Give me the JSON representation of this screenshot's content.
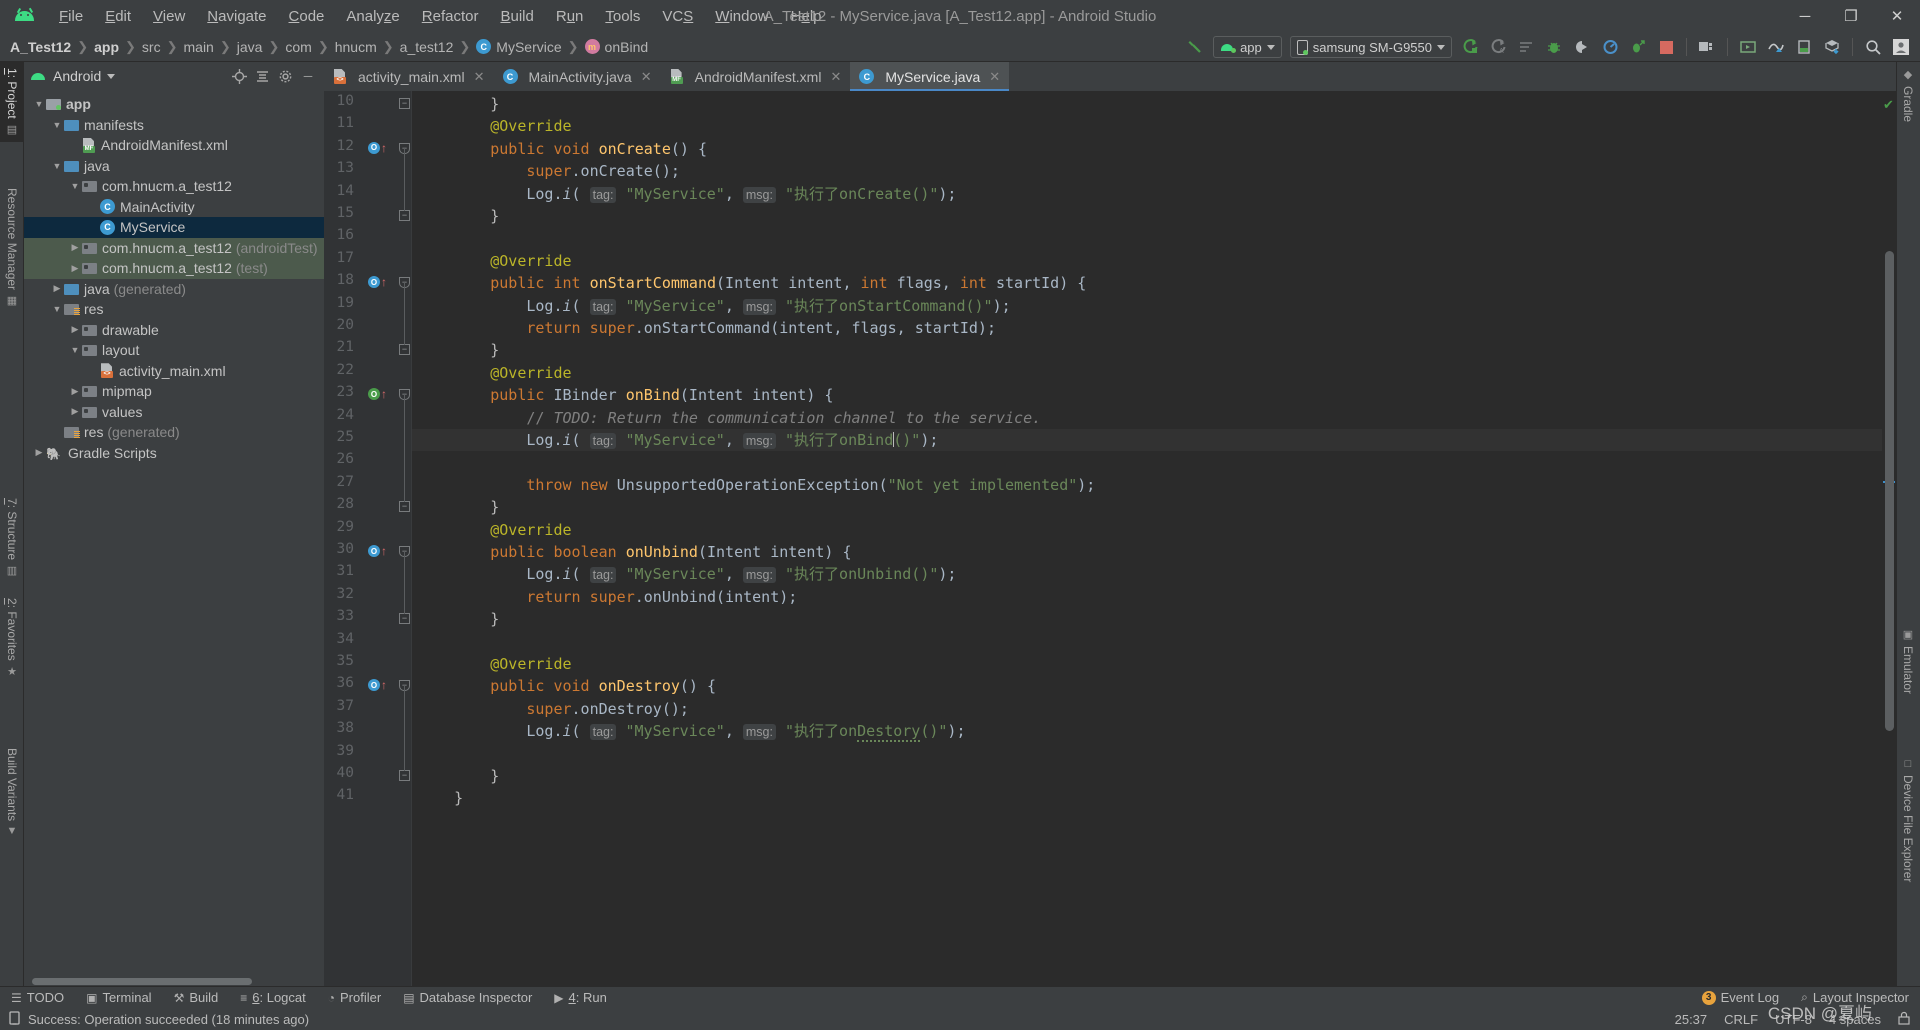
{
  "window": {
    "title": "A_Test12 - MyService.java [A_Test12.app] - Android Studio",
    "minimize": "─",
    "maximize": "❐",
    "close": "✕"
  },
  "menubar": {
    "items": [
      "File",
      "Edit",
      "View",
      "Navigate",
      "Code",
      "Analyze",
      "Refactor",
      "Build",
      "Run",
      "Tools",
      "VCS",
      "Window",
      "Help"
    ]
  },
  "breadcrumb": {
    "items": [
      {
        "label": "A_Test12",
        "bold": true,
        "icon": ""
      },
      {
        "label": "app",
        "bold": true,
        "icon": ""
      },
      {
        "label": "src",
        "bold": false,
        "icon": ""
      },
      {
        "label": "main",
        "bold": false,
        "icon": ""
      },
      {
        "label": "java",
        "bold": false,
        "icon": ""
      },
      {
        "label": "com",
        "bold": false,
        "icon": ""
      },
      {
        "label": "hnucm",
        "bold": false,
        "icon": ""
      },
      {
        "label": "a_test12",
        "bold": false,
        "icon": ""
      },
      {
        "label": "MyService",
        "bold": false,
        "icon": "class-icon",
        "glyph": "C"
      },
      {
        "label": "onBind",
        "bold": false,
        "icon": "method-icon",
        "glyph": "m"
      }
    ]
  },
  "toolbar": {
    "build_hammer": "build-icon",
    "run_config": "app",
    "device": "samsung SM-G9550",
    "icons": [
      "run-icon",
      "run-coverage-icon",
      "run-with-profiler-lines-icon",
      "debug-icon",
      "attach-debugger-icon",
      "profiler-icon",
      "debug-attach-icon",
      "stop-icon",
      "avd-manager-icon",
      "layout-editor-icon",
      "sdk-manager-icon",
      "device-manager-icon",
      "gradle-sync-icon",
      "search-icon",
      "account-icon"
    ]
  },
  "left_tool_window": {
    "tabs": [
      {
        "label": "1: Project",
        "underline": "1",
        "active": true
      },
      {
        "label": "Resource Manager",
        "active": false
      },
      {
        "label": "7: Structure",
        "underline": "7",
        "active": false
      },
      {
        "label": "2: Favorites",
        "underline": "2",
        "active": false
      },
      {
        "label": "Build Variants",
        "active": false
      }
    ]
  },
  "right_tool_window": {
    "tabs": [
      {
        "label": "Gradle",
        "icon": "elephant-icon"
      },
      {
        "label": "Emulator",
        "icon": "emulator-icon"
      },
      {
        "label": "Device File Explorer",
        "icon": "device-icon"
      }
    ]
  },
  "project_panel": {
    "view_name": "Android",
    "header_icons": [
      "locate-icon",
      "collapse-all-icon",
      "settings-gear-icon",
      "hide-icon"
    ],
    "tree": [
      {
        "label": "app",
        "indent": 0,
        "arrow": "down",
        "icon": "module-folder",
        "bold": true
      },
      {
        "label": "manifests",
        "indent": 1,
        "arrow": "down",
        "icon": "folder-blue"
      },
      {
        "label": "AndroidManifest.xml",
        "indent": 2,
        "arrow": "none",
        "icon": "xml-manifest"
      },
      {
        "label": "java",
        "indent": 1,
        "arrow": "down",
        "icon": "folder-blue"
      },
      {
        "label": "com.hnucm.a_test12",
        "indent": 2,
        "arrow": "down",
        "icon": "package"
      },
      {
        "label": "MainActivity",
        "indent": 3,
        "arrow": "none",
        "icon": "class"
      },
      {
        "label": "MyService",
        "indent": 3,
        "arrow": "none",
        "icon": "class",
        "selected": true
      },
      {
        "label": "com.hnucm.a_test12 (androidTest)",
        "indent": 2,
        "arrow": "right",
        "icon": "package",
        "green": true
      },
      {
        "label": "com.hnucm.a_test12 (test)",
        "indent": 2,
        "arrow": "right",
        "icon": "package",
        "green": true
      },
      {
        "label": "java (generated)",
        "indent": 1,
        "arrow": "right",
        "icon": "folder-gen"
      },
      {
        "label": "res",
        "indent": 1,
        "arrow": "down",
        "icon": "folder-res"
      },
      {
        "label": "drawable",
        "indent": 2,
        "arrow": "right",
        "icon": "package"
      },
      {
        "label": "layout",
        "indent": 2,
        "arrow": "down",
        "icon": "package"
      },
      {
        "label": "activity_main.xml",
        "indent": 3,
        "arrow": "none",
        "icon": "xml-layout"
      },
      {
        "label": "mipmap",
        "indent": 2,
        "arrow": "right",
        "icon": "package"
      },
      {
        "label": "values",
        "indent": 2,
        "arrow": "right",
        "icon": "package"
      },
      {
        "label": "res (generated)",
        "indent": 1,
        "arrow": "none",
        "icon": "folder-res"
      },
      {
        "label": "Gradle Scripts",
        "indent": 0,
        "arrow": "right",
        "icon": "gradle"
      }
    ]
  },
  "editor": {
    "tabs": [
      {
        "label": "activity_main.xml",
        "icon": "xml-layout-icon",
        "active": false
      },
      {
        "label": "MainActivity.java",
        "icon": "class-icon",
        "active": false
      },
      {
        "label": "AndroidManifest.xml",
        "icon": "xml-manifest-icon",
        "active": false
      },
      {
        "label": "MyService.java",
        "icon": "class-icon",
        "active": true
      }
    ],
    "close_glyph": "✕",
    "first_line": 10,
    "last_line": 41,
    "caret_line": 25
  },
  "code_lines": [
    {
      "n": 10,
      "html": "        }"
    },
    {
      "n": 11,
      "html": "        <span class='anno'>@Override</span>"
    },
    {
      "n": 12,
      "html": "        <span class='kw'>public</span> <span class='kw'>void</span> <span class='meth'>onCreate</span><span class='plain'>() {</span>",
      "gutter": "override-blue"
    },
    {
      "n": 13,
      "html": "            <span class='kw'>super</span><span class='plain'>.onCreate();</span>"
    },
    {
      "n": 14,
      "html": "            <span class='plain'>Log.</span><span class='plain' style='font-style:italic'>i</span><span class='plain'>( </span><span class='hint'>tag:</span><span class='str'> \"MyService\"</span><span class='plain'>, </span><span class='hint'>msg:</span><span class='str'> \"执行了onCreate()\"</span><span class='plain'>);</span>"
    },
    {
      "n": 15,
      "html": "        }"
    },
    {
      "n": 16,
      "html": ""
    },
    {
      "n": 17,
      "html": "        <span class='anno'>@Override</span>"
    },
    {
      "n": 18,
      "html": "        <span class='kw'>public</span> <span class='kw'>int</span> <span class='meth'>onStartCommand</span><span class='plain'>(Intent intent, </span><span class='kw'>int</span><span class='plain'> flags, </span><span class='kw'>int</span><span class='plain'> startId) {</span>",
      "gutter": "override-blue"
    },
    {
      "n": 19,
      "html": "            <span class='plain'>Log.</span><span class='plain' style='font-style:italic'>i</span><span class='plain'>( </span><span class='hint'>tag:</span><span class='str'> \"MyService\"</span><span class='plain'>, </span><span class='hint'>msg:</span><span class='str'> \"执行了onStartCommand()\"</span><span class='plain'>);</span>"
    },
    {
      "n": 20,
      "html": "            <span class='kw'>return</span> <span class='kw'>super</span><span class='plain'>.onStartCommand(intent, flags, startId);</span>"
    },
    {
      "n": 21,
      "html": "        }"
    },
    {
      "n": 22,
      "html": "        <span class='anno'>@Override</span>"
    },
    {
      "n": 23,
      "html": "        <span class='kw'>public</span> <span class='plain'>IBinder </span><span class='meth'>onBind</span><span class='plain'>(Intent intent) {</span>",
      "gutter": "override-green"
    },
    {
      "n": 24,
      "html": "            <span class='cmt-b'>// </span><span class='cmt'>TODO: Return the communication channel to the service.</span>"
    },
    {
      "n": 25,
      "html": "            <span class='plain'>Log.</span><span class='plain' style='font-style:italic'>i</span><span class='plain'>( </span><span class='hint'>tag:</span><span class='str'> \"MyService\"</span><span class='plain'>, </span><span class='hint'>msg:</span><span class='str'> \"执行了onBind</span><span class='cursor-bar'></span><span class='str'>()\"</span><span class='plain'>);</span>",
      "caret": true
    },
    {
      "n": 26,
      "html": ""
    },
    {
      "n": 27,
      "html": "            <span class='kw'>throw new</span> <span class='plain'>UnsupportedOperationException(</span><span class='str'>\"Not yet implemented\"</span><span class='plain'>);</span>"
    },
    {
      "n": 28,
      "html": "        }"
    },
    {
      "n": 29,
      "html": "        <span class='anno'>@Override</span>"
    },
    {
      "n": 30,
      "html": "        <span class='kw'>public</span> <span class='kw'>boolean</span> <span class='meth'>onUnbind</span><span class='plain'>(Intent intent) {</span>",
      "gutter": "override-blue"
    },
    {
      "n": 31,
      "html": "            <span class='plain'>Log.</span><span class='plain' style='font-style:italic'>i</span><span class='plain'>( </span><span class='hint'>tag:</span><span class='str'> \"MyService\"</span><span class='plain'>, </span><span class='hint'>msg:</span><span class='str'> \"执行了onUnbind()\"</span><span class='plain'>);</span>"
    },
    {
      "n": 32,
      "html": "            <span class='kw'>return</span> <span class='kw'>super</span><span class='plain'>.onUnbind(intent);</span>"
    },
    {
      "n": 33,
      "html": "        }"
    },
    {
      "n": 34,
      "html": ""
    },
    {
      "n": 35,
      "html": "        <span class='anno'>@Override</span>"
    },
    {
      "n": 36,
      "html": "        <span class='kw'>public</span> <span class='kw'>void</span> <span class='meth'>onDestroy</span><span class='plain'>() {</span>",
      "gutter": "override-blue"
    },
    {
      "n": 37,
      "html": "            <span class='kw'>super</span><span class='plain'>.onDestroy();</span>"
    },
    {
      "n": 38,
      "html": "            <span class='plain'>Log.</span><span class='plain' style='font-style:italic'>i</span><span class='plain'>( </span><span class='hint'>tag:</span><span class='str'> \"MyService\"</span><span class='plain'>, </span><span class='hint'>msg:</span><span class='str'> \"执行了on</span><span class='str squig'>Destory</span><span class='str'>()\"</span><span class='plain'>);</span>"
    },
    {
      "n": 39,
      "html": ""
    },
    {
      "n": 40,
      "html": "        }"
    },
    {
      "n": 41,
      "html": "    }"
    }
  ],
  "bottom_bar": {
    "items": [
      {
        "label": "TODO",
        "icon": "todo-icon"
      },
      {
        "label": "Terminal",
        "icon": "terminal-icon"
      },
      {
        "label": "Build",
        "icon": "build-hammer-icon"
      },
      {
        "label": "6: Logcat",
        "icon": "logcat-icon",
        "underline": "6"
      },
      {
        "label": "Profiler",
        "icon": "profiler-icon"
      },
      {
        "label": "Database Inspector",
        "icon": "database-icon"
      },
      {
        "label": "4: Run",
        "icon": "run-play-icon",
        "underline": "4"
      }
    ],
    "right": [
      {
        "label": "Event Log",
        "badge": "3"
      },
      {
        "label": "Layout Inspector",
        "icon": "layout-inspector-icon"
      }
    ]
  },
  "status_bar": {
    "message": "Success: Operation succeeded (18 minutes ago)",
    "icon": "info-icon",
    "right": [
      "25:37",
      "CRLF",
      "UTF-8",
      "4 spaces"
    ],
    "lock_icon": "lock-icon"
  },
  "watermark": "CSDN @夏屿"
}
